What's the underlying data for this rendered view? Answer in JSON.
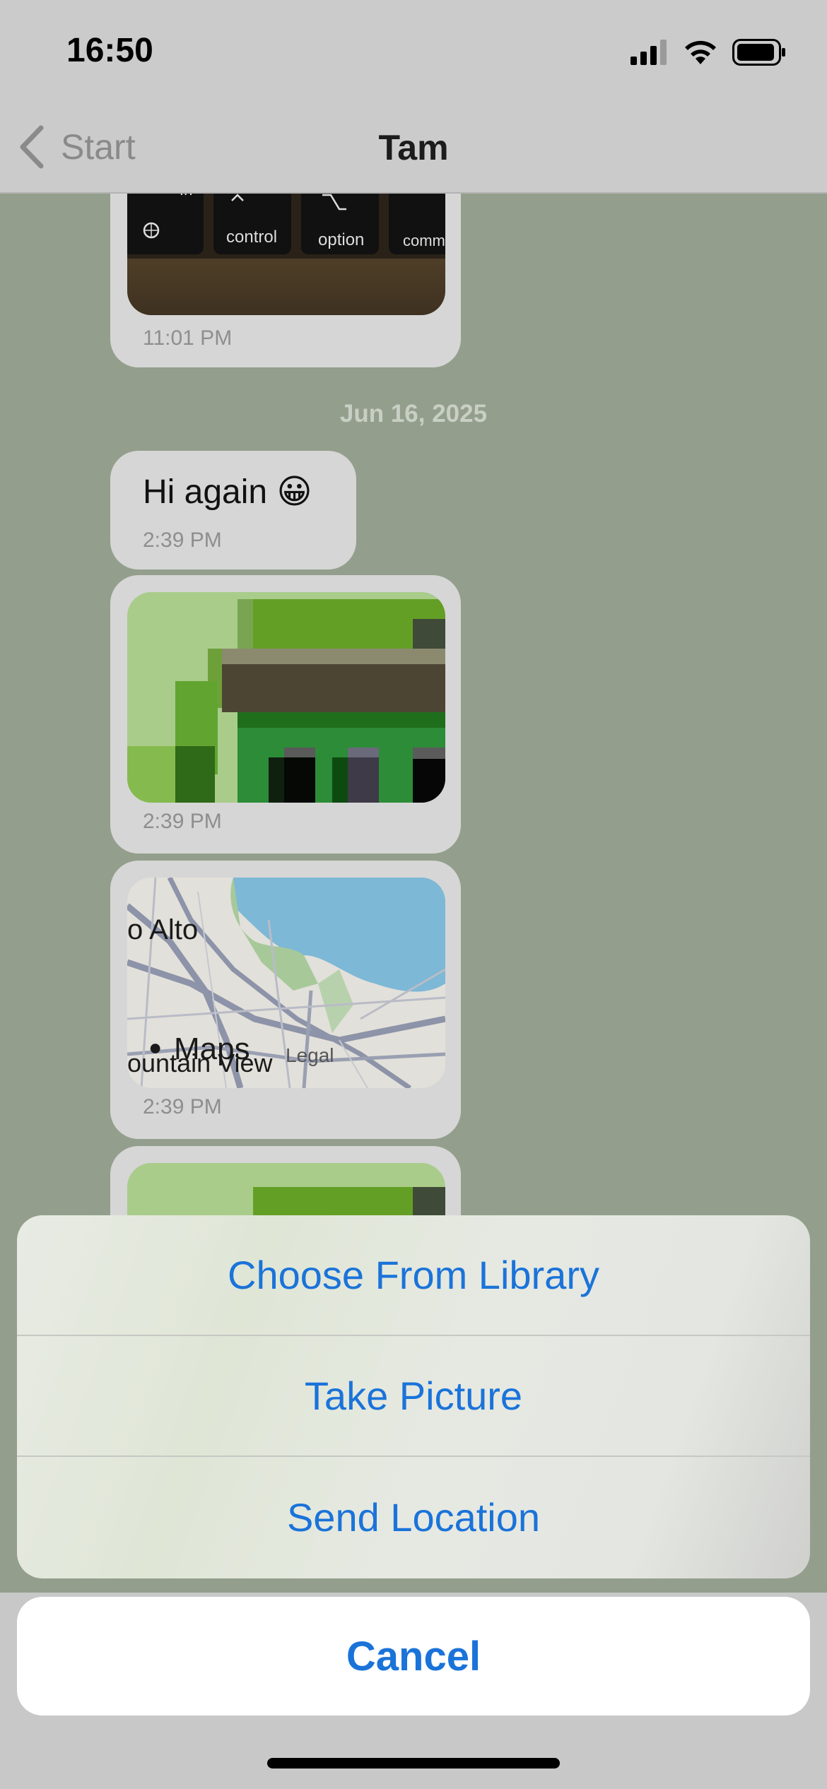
{
  "status_bar": {
    "time": "16:50",
    "signal_icon": "signal-icon",
    "wifi_icon": "wifi-icon",
    "battery_icon": "battery-icon"
  },
  "nav": {
    "back_label": "Start",
    "title": "Tam"
  },
  "chat": {
    "messages": [
      {
        "type": "photo",
        "subject": "keyboard",
        "keys": [
          "fn",
          "control",
          "option",
          "comm"
        ],
        "time": "11:01 PM"
      },
      {
        "type": "date_separator",
        "text": "Jun 16, 2025"
      },
      {
        "type": "text",
        "text": "Hi again 😀",
        "time": "2:39 PM"
      },
      {
        "type": "photo",
        "subject": "pixel-art",
        "time": "2:39 PM"
      },
      {
        "type": "map",
        "labels": [
          "o Alto",
          "Maps",
          "ountain View",
          "Legal"
        ],
        "time": "2:39 PM"
      },
      {
        "type": "photo",
        "subject": "pixel-art"
      }
    ]
  },
  "action_sheet": {
    "items": [
      "Choose From Library",
      "Take Picture",
      "Send Location"
    ],
    "cancel": "Cancel"
  },
  "colors": {
    "accent": "#1a73d9",
    "chat_background": "#939f8c",
    "bubble": "#d6d6d6"
  }
}
